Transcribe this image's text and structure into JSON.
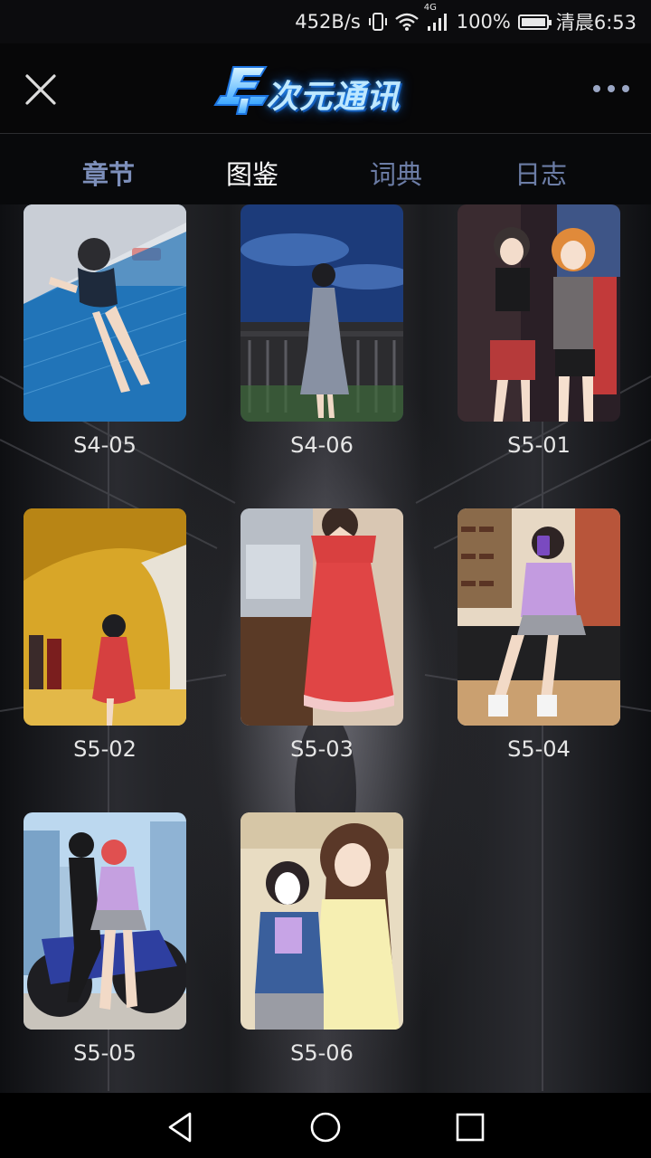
{
  "status_bar": {
    "speed": "452B/s",
    "network": "4G",
    "battery": "100%",
    "battery_level": 1.0,
    "time": "清晨6:53",
    "icons": [
      "vibrate-icon",
      "wifi-icon",
      "signal-icon",
      "battery-icon"
    ]
  },
  "header": {
    "logo_text": "次元通讯",
    "close_icon": "close-icon",
    "more_icon": "more-icon"
  },
  "tabs": [
    {
      "label": "章节"
    },
    {
      "label": "图鉴"
    },
    {
      "label": "词典"
    },
    {
      "label": "日志"
    }
  ],
  "gallery": {
    "items": [
      {
        "label": "S4-05"
      },
      {
        "label": "S4-06"
      },
      {
        "label": "S5-01"
      },
      {
        "label": "S5-02"
      },
      {
        "label": "S5-03"
      },
      {
        "label": "S5-04"
      },
      {
        "label": "S5-05"
      },
      {
        "label": "S5-06"
      }
    ]
  },
  "navbar": {
    "back_icon": "back-icon",
    "home_icon": "home-icon",
    "recents_icon": "recents-icon"
  }
}
